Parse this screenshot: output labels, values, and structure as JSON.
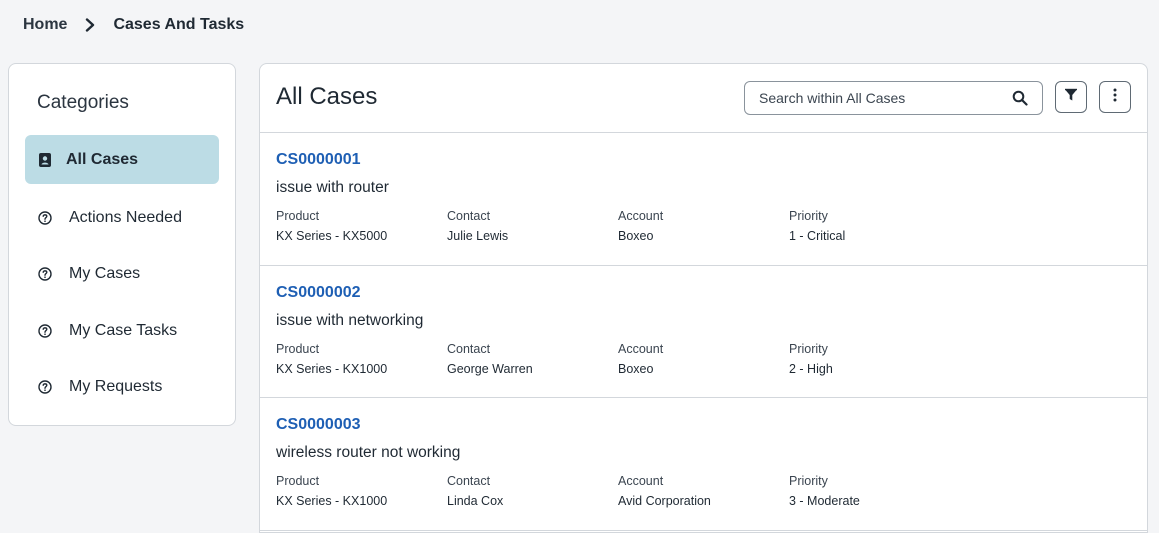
{
  "breadcrumb": {
    "home": "Home",
    "current": "Cases And Tasks"
  },
  "sidebar": {
    "title": "Categories",
    "items": [
      {
        "label": "All Cases",
        "active": true,
        "icon": "contact-book-icon"
      },
      {
        "label": "Actions Needed",
        "active": false,
        "icon": "question-circle-icon"
      },
      {
        "label": "My Cases",
        "active": false,
        "icon": "question-circle-icon"
      },
      {
        "label": "My Case Tasks",
        "active": false,
        "icon": "question-circle-icon"
      },
      {
        "label": "My Requests",
        "active": false,
        "icon": "question-circle-icon"
      }
    ]
  },
  "main": {
    "title": "All Cases",
    "search": {
      "placeholder": "Search within All Cases",
      "value": ""
    },
    "field_labels": {
      "product": "Product",
      "contact": "Contact",
      "account": "Account",
      "priority": "Priority"
    },
    "cases": [
      {
        "number": "CS0000001",
        "description": "issue with router",
        "product": "KX Series - KX5000",
        "contact": "Julie Lewis",
        "account": "Boxeo",
        "priority": "1 - Critical"
      },
      {
        "number": "CS0000002",
        "description": "issue with networking",
        "product": "KX Series - KX1000",
        "contact": "George Warren",
        "account": "Boxeo",
        "priority": "2 - High"
      },
      {
        "number": "CS0000003",
        "description": "wireless router not working",
        "product": "KX Series - KX1000",
        "contact": "Linda Cox",
        "account": "Avid Corporation",
        "priority": "3 - Moderate"
      }
    ]
  },
  "colors": {
    "accent_link": "#1e5fb4",
    "active_item_bg": "#bcdce5",
    "border": "#d3d7dc"
  }
}
